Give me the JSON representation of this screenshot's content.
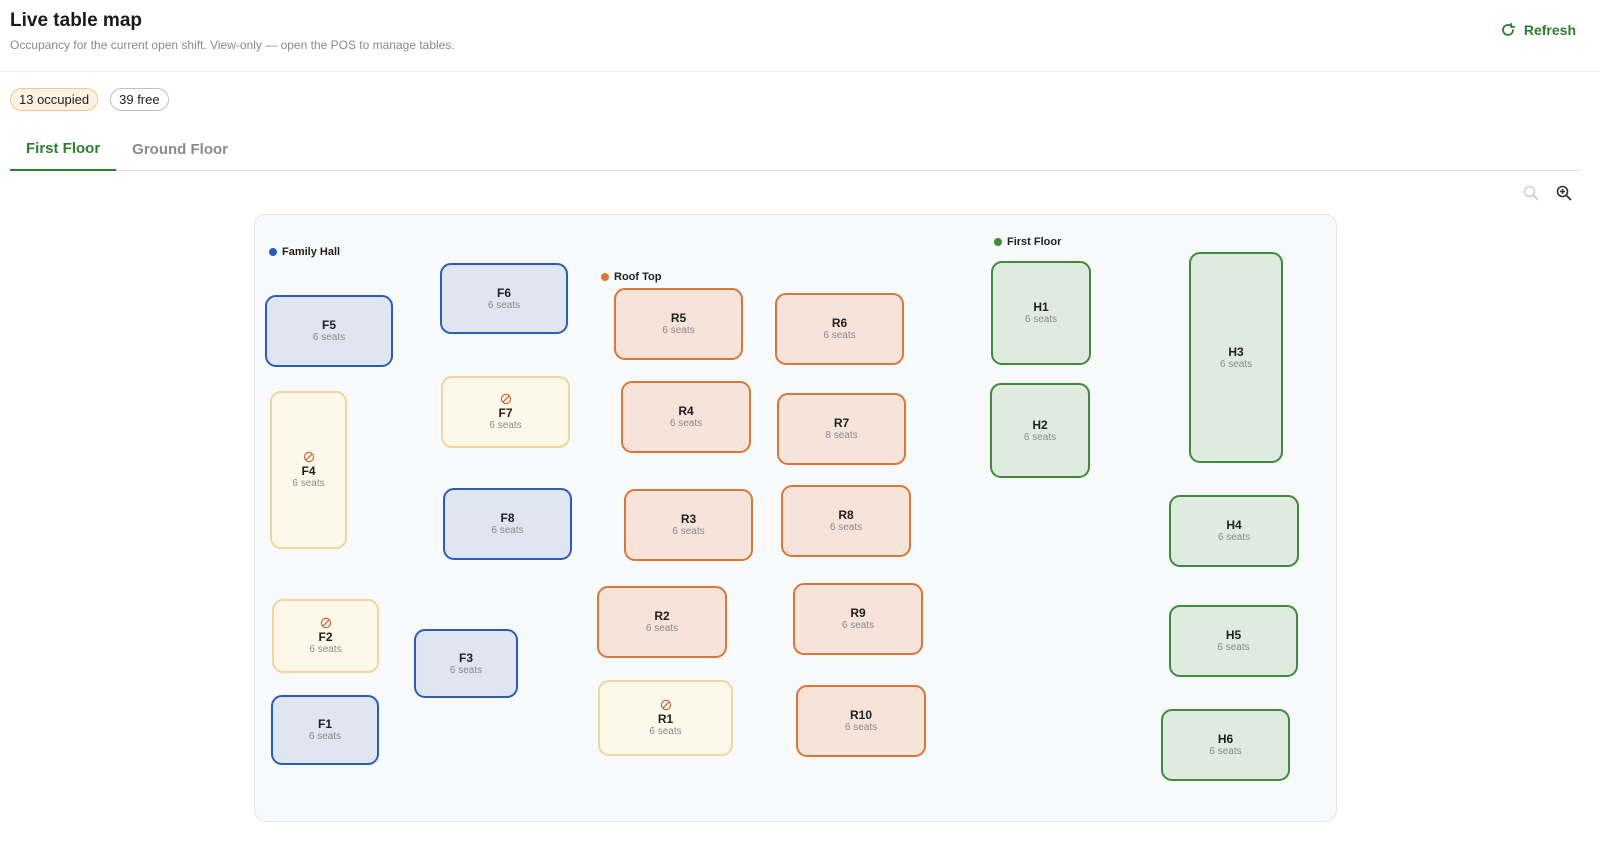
{
  "header": {
    "title": "Live table map",
    "subtitle": "Occupancy for the current open shift. View-only — open the POS to manage tables.",
    "refresh_label": "Refresh"
  },
  "summary": {
    "occupied": "13 occupied",
    "free": "39 free"
  },
  "tabs": [
    {
      "label": "First Floor",
      "active": true
    },
    {
      "label": "Ground Floor",
      "active": false
    }
  ],
  "icons": {
    "refresh": "refresh-icon",
    "zoom_out": "zoom-out-icon",
    "zoom_in": "zoom-in-icon",
    "occupied": "blocked-icon"
  },
  "colors": {
    "accent": "#2e7d32",
    "family_hall": "#2d5cb8",
    "roof_top": "#d9773a",
    "first_floor": "#3f8a3d",
    "occupied_border": "#f2d49f"
  },
  "areas": {
    "family_hall": "Family Hall",
    "roof_top": "Roof Top",
    "first_floor": "First Floor"
  },
  "tables": {
    "F1": {
      "name": "F1",
      "seats": "6 seats",
      "occupied": false
    },
    "F2": {
      "name": "F2",
      "seats": "6 seats",
      "occupied": true
    },
    "F3": {
      "name": "F3",
      "seats": "6 seats",
      "occupied": false
    },
    "F4": {
      "name": "F4",
      "seats": "6 seats",
      "occupied": true
    },
    "F5": {
      "name": "F5",
      "seats": "6 seats",
      "occupied": false
    },
    "F6": {
      "name": "F6",
      "seats": "6 seats",
      "occupied": false
    },
    "F7": {
      "name": "F7",
      "seats": "6 seats",
      "occupied": true
    },
    "F8": {
      "name": "F8",
      "seats": "6 seats",
      "occupied": false
    },
    "R1": {
      "name": "R1",
      "seats": "6 seats",
      "occupied": true
    },
    "R2": {
      "name": "R2",
      "seats": "6 seats",
      "occupied": false
    },
    "R3": {
      "name": "R3",
      "seats": "6 seats",
      "occupied": false
    },
    "R4": {
      "name": "R4",
      "seats": "6 seats",
      "occupied": false
    },
    "R5": {
      "name": "R5",
      "seats": "6 seats",
      "occupied": false
    },
    "R6": {
      "name": "R6",
      "seats": "6 seats",
      "occupied": false
    },
    "R7": {
      "name": "R7",
      "seats": "8 seats",
      "occupied": false
    },
    "R8": {
      "name": "R8",
      "seats": "6 seats",
      "occupied": false
    },
    "R9": {
      "name": "R9",
      "seats": "6 seats",
      "occupied": false
    },
    "R10": {
      "name": "R10",
      "seats": "6 seats",
      "occupied": false
    },
    "H1": {
      "name": "H1",
      "seats": "6 seats",
      "occupied": false
    },
    "H2": {
      "name": "H2",
      "seats": "6 seats",
      "occupied": false
    },
    "H3": {
      "name": "H3",
      "seats": "6 seats",
      "occupied": false
    },
    "H4": {
      "name": "H4",
      "seats": "6 seats",
      "occupied": false
    },
    "H5": {
      "name": "H5",
      "seats": "6 seats",
      "occupied": false
    },
    "H6": {
      "name": "H6",
      "seats": "6 seats",
      "occupied": false
    }
  }
}
